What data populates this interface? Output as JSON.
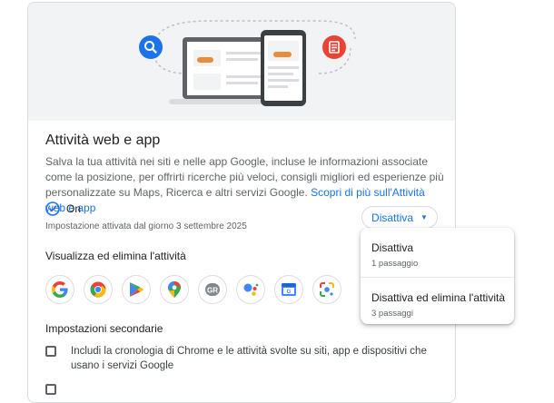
{
  "activity": {
    "title": "Attività web e app",
    "description_before_link": "Salva la tua attività nei siti e nelle app Google, incluse le informazioni associate come la posizione, per offrirti ricerche più veloci, consigli migliori ed esperienze più personalizzate su Maps, Ricerca e altri servizi Google. ",
    "learn_more_link": "Scopri di più sull'Attività web e app",
    "status": "On",
    "since": "Impostazione attivata dal giorno 3 settembre 2025",
    "disable_button": "Disattiva"
  },
  "view_delete": {
    "title": "Visualizza ed elimina l'attività",
    "apps": [
      {
        "name": "google-icon"
      },
      {
        "name": "chrome-icon"
      },
      {
        "name": "play-store-icon"
      },
      {
        "name": "maps-icon"
      },
      {
        "name": "google-news-icon"
      },
      {
        "name": "assistant-icon"
      },
      {
        "name": "google-calendar-icon"
      },
      {
        "name": "lens-icon"
      }
    ]
  },
  "secondary": {
    "title": "Impostazioni secondarie",
    "chrome_history_label": "Includi la cronologia di Chrome e le attività svolte su siti, app e dispositivi che usano i servizi Google"
  },
  "menu": {
    "items": [
      {
        "title": "Disattiva",
        "subtitle": "1 passaggio"
      },
      {
        "title": "Disattiva ed elimina l'attività",
        "subtitle": "3 passaggi"
      }
    ]
  },
  "colors": {
    "accent": "#1a73e8",
    "google_blue": "#4285f4",
    "google_red": "#ea4335",
    "google_yellow": "#fbbc04",
    "google_green": "#34a853"
  }
}
